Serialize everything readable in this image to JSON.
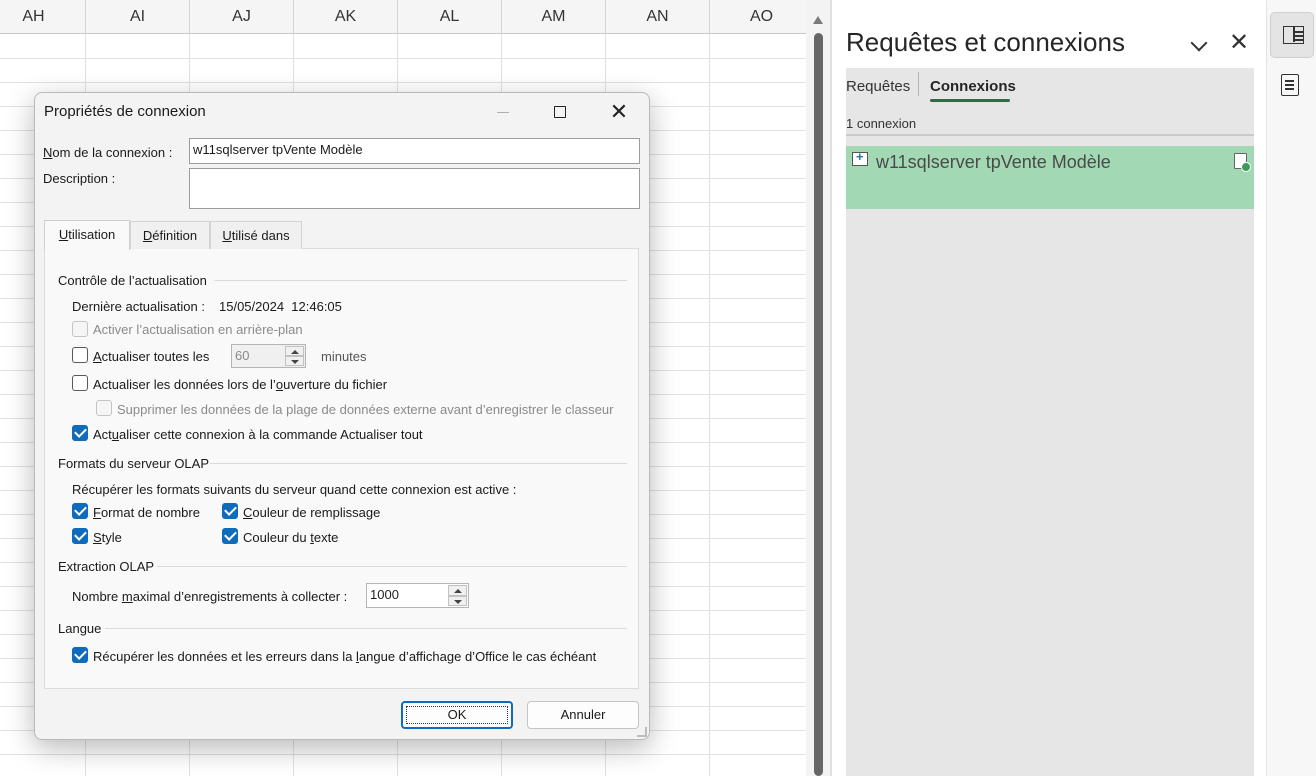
{
  "sheet": {
    "columns": [
      "AH",
      "AI",
      "AJ",
      "AK",
      "AL",
      "AM",
      "AN",
      "AO"
    ]
  },
  "dialog": {
    "title": "Propriétés de connexion",
    "name_label_pre": "N",
    "name_label_post": "om de la connexion :",
    "name_value": "w11sqlserver tpVente Modèle",
    "description_label": "Description :",
    "description_value": "",
    "tabs": [
      {
        "pre": "",
        "ul": "U",
        "post": "tilisation"
      },
      {
        "pre": "",
        "ul": "D",
        "post": "éfinition"
      },
      {
        "pre": "",
        "ul": "U",
        "post": "tilisé dans"
      }
    ],
    "refresh_group": "Contrôle de l’actualisation",
    "last_refresh_label": "Dernière actualisation :",
    "last_refresh_value": "15/05/2024  12:46:05",
    "bg_refresh_label": "Activer l’actualisation en arrière-plan",
    "refresh_every_pre": "",
    "refresh_every_ul": "A",
    "refresh_every_post": "ctualiser toutes les",
    "refresh_minutes_value": "60",
    "minutes_label": "minutes",
    "refresh_on_open_pre": "Actualiser les données lors de l’",
    "refresh_on_open_ul": "o",
    "refresh_on_open_post": "uverture du fichier",
    "remove_data_label": "Supprimer les données de la plage de données externe avant d’enregistrer le classeur",
    "refresh_all_pre": "Act",
    "refresh_all_ul": "u",
    "refresh_all_post": "aliser cette connexion à la commande Actualiser tout",
    "olap_formats_group": "Formats du serveur OLAP",
    "olap_formats_intro": "Récupérer les formats suivants du serveur quand cette connexion est active :",
    "fmt_number_pre": "",
    "fmt_number_ul": "F",
    "fmt_number_post": "ormat de nombre",
    "fmt_fill_pre": "",
    "fmt_fill_ul": "C",
    "fmt_fill_post": "ouleur de remplissage",
    "fmt_style_pre": "",
    "fmt_style_ul": "S",
    "fmt_style_post": "tyle",
    "fmt_textcolor_pre": "Couleur du ",
    "fmt_textcolor_ul": "t",
    "fmt_textcolor_post": "exte",
    "olap_extract_group": "Extraction OLAP",
    "max_records_pre": "Nombre ",
    "max_records_ul": "m",
    "max_records_post": "aximal d’enregistrements à collecter :",
    "max_records_value": "1000",
    "language_group": "Langue",
    "language_pre": "Récupérer les données et les erreurs dans la ",
    "language_ul": "l",
    "language_post": "angue d’affichage d’Office le cas échéant",
    "ok_label": "OK",
    "cancel_label": "Annuler"
  },
  "pane": {
    "title": "Requêtes et connexions",
    "tab_queries": "Requêtes",
    "tab_connections": "Connexions",
    "connection_count": "1 connexion",
    "connection_name": "w11sqlserver tpVente Modèle"
  },
  "colors": {
    "accent": "#0f6cbd",
    "excel_green": "#217346",
    "selected_connection": "#a3d8b5"
  }
}
